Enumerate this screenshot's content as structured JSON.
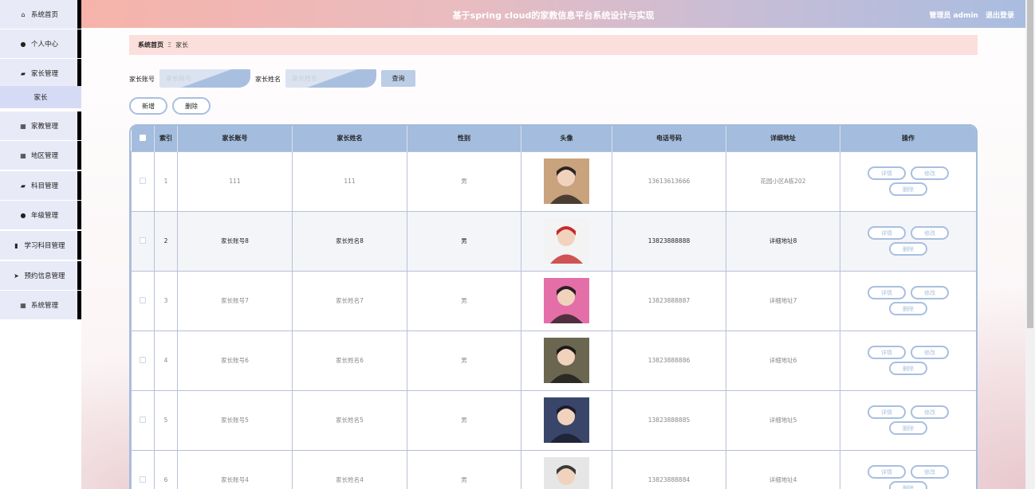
{
  "header": {
    "title": "基于spring cloud的家教信息平台系统设计与实现",
    "user_label": "管理员 admin",
    "logout": "退出登录"
  },
  "sidebar": {
    "items": [
      {
        "label": "系统首页",
        "icon": "home-icon"
      },
      {
        "label": "个人中心",
        "icon": "user-icon"
      },
      {
        "label": "家长管理",
        "icon": "briefcase-icon"
      },
      {
        "label": "家教管理",
        "icon": "grid-icon"
      },
      {
        "label": "地区管理",
        "icon": "grid-icon"
      },
      {
        "label": "科目管理",
        "icon": "briefcase-icon"
      },
      {
        "label": "年级管理",
        "icon": "user-icon"
      },
      {
        "label": "学习科目管理",
        "icon": "bar-chart-icon"
      },
      {
        "label": "预约信息管理",
        "icon": "send-icon"
      },
      {
        "label": "系统管理",
        "icon": "grid-icon"
      }
    ],
    "subitem": "家长"
  },
  "breadcrumb": {
    "home": "系统首页",
    "sep": "Ξ",
    "current": "家长"
  },
  "search": {
    "account_label": "家长账号",
    "account_placeholder": "家长账号",
    "name_label": "家长姓名",
    "name_placeholder": "家长姓名",
    "query": "查询"
  },
  "actions": {
    "add": "新增",
    "delete": "删除"
  },
  "table": {
    "headers": [
      "索引",
      "家长账号",
      "家长姓名",
      "性别",
      "头像",
      "电话号码",
      "详细地址",
      "操作"
    ],
    "ops": {
      "detail": "详情",
      "edit": "修改",
      "delete": "删除"
    },
    "rows": [
      {
        "index": "1",
        "account": "111",
        "name": "111",
        "gender": "男",
        "phone": "13613613666",
        "address": "花园小区A栋202"
      },
      {
        "index": "2",
        "account": "家长账号8",
        "name": "家长姓名8",
        "gender": "男",
        "phone": "13823888888",
        "address": "详细地址8"
      },
      {
        "index": "3",
        "account": "家长账号7",
        "name": "家长姓名7",
        "gender": "男",
        "phone": "13823888887",
        "address": "详细地址7"
      },
      {
        "index": "4",
        "account": "家长账号6",
        "name": "家长姓名6",
        "gender": "男",
        "phone": "13823888886",
        "address": "详细地址6"
      },
      {
        "index": "5",
        "account": "家长账号5",
        "name": "家长姓名5",
        "gender": "男",
        "phone": "13823888885",
        "address": "详细地址5"
      },
      {
        "index": "6",
        "account": "家长账号4",
        "name": "家长姓名4",
        "gender": "男",
        "phone": "13823888884",
        "address": "详细地址4"
      }
    ]
  }
}
